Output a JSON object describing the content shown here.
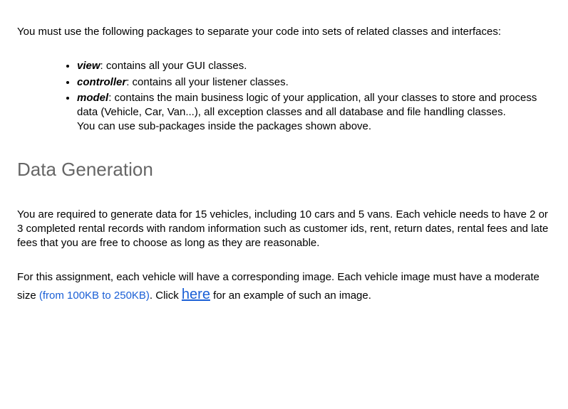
{
  "intro": "You must use the following packages to separate your code into sets of related classes and interfaces:",
  "packages": [
    {
      "name": "view",
      "desc": ": contains all your GUI classes."
    },
    {
      "name": "controller",
      "desc": ": contains all your listener classes."
    },
    {
      "name": "model",
      "desc": ": contains the main business logic of your application, all your classes to store and process data (Vehicle, Car, Van...), all exception classes and all database and file handling classes."
    }
  ],
  "subpkg_note": "You can use sub-packages inside the packages shown above.",
  "heading": "Data Generation",
  "para1": "You are required to generate data for 15 vehicles, including 10 cars and 5 vans. Each vehicle needs to have 2 or 3 completed rental records with random information such as customer ids, rent, return dates, rental fees and late fees that you are free to choose as long as they are reasonable.",
  "para2_a": "For this assignment, each vehicle will have a corresponding image. Each vehicle image must have a moderate size ",
  "size_note": "(from 100KB to 250KB)",
  "para2_b": ". Click ",
  "here": "here",
  "para2_c": " for an example of such an image."
}
